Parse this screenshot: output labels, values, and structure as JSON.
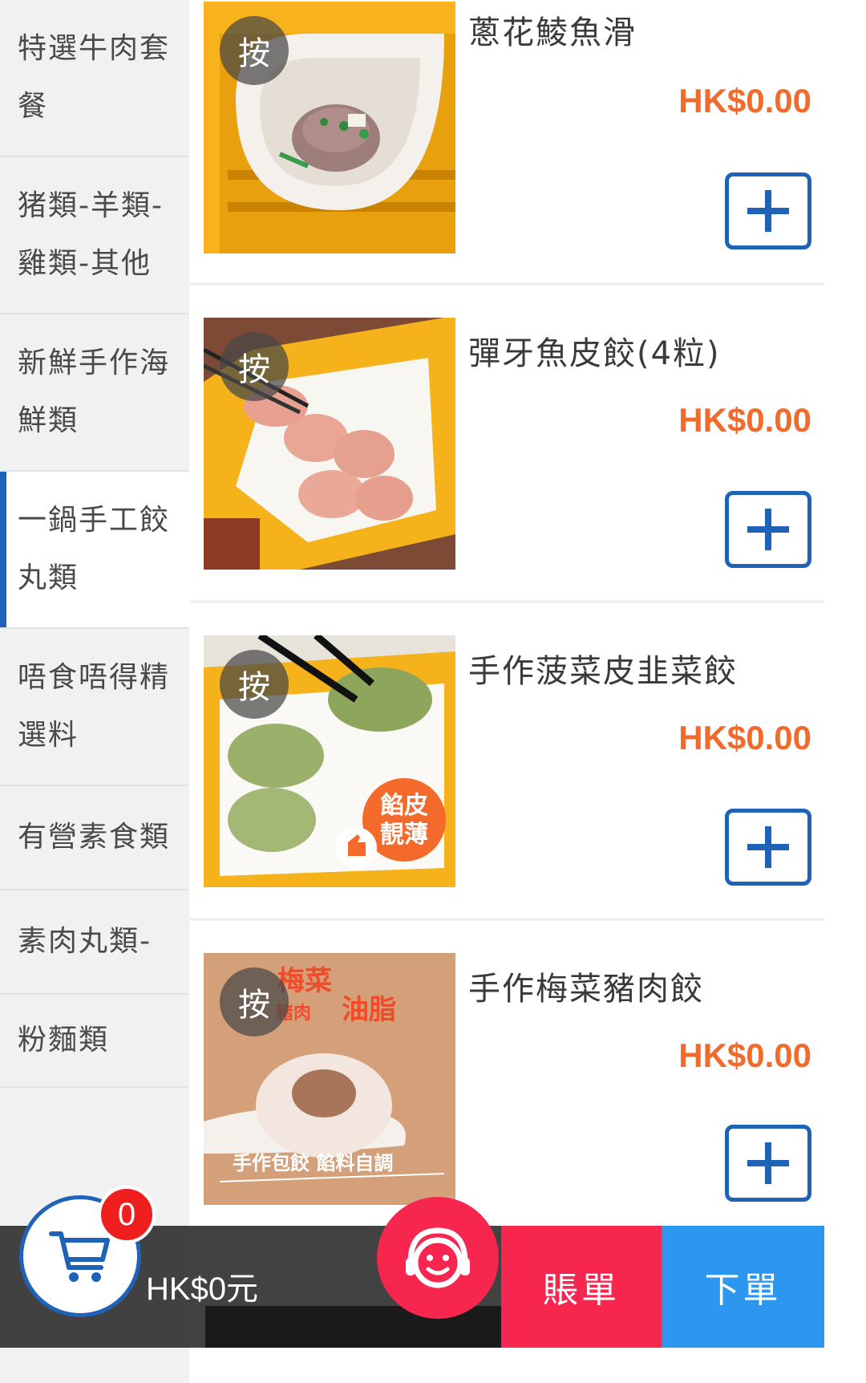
{
  "sidebar": {
    "categories": [
      {
        "label": "特選牛肉套餐"
      },
      {
        "label": "猪類-羊類-雞類-其他"
      },
      {
        "label": "新鮮手作海鮮類"
      },
      {
        "label": "一鍋手工餃丸類",
        "active": true
      },
      {
        "label": "唔食唔得精選料"
      },
      {
        "label": "有營素食類"
      },
      {
        "label": "素肉丸類-"
      },
      {
        "label": "粉麵類"
      }
    ]
  },
  "items": [
    {
      "badge": "按",
      "name": "蔥花鯪魚滑",
      "price": "HK$0.00"
    },
    {
      "badge": "按",
      "name": "彈牙魚皮餃(4粒)",
      "price": "HK$0.00"
    },
    {
      "badge": "按",
      "name": "手作菠菜皮韭菜餃",
      "price": "HK$0.00",
      "image_text": "餡皮靚薄"
    },
    {
      "badge": "按",
      "name": "手作梅菜豬肉餃",
      "price": "HK$0.00",
      "image_text": [
        "梅菜",
        "豬肉",
        "油脂",
        "手作包餃 餡料自調"
      ]
    }
  ],
  "cart": {
    "count": "0",
    "total": "HK$0元"
  },
  "actions": {
    "bill": "賬單",
    "order": "下單"
  },
  "colors": {
    "accent_blue": "#1e63b8",
    "price_orange": "#f06b2c",
    "bill_red": "#f6264f",
    "order_blue": "#2d97f0"
  },
  "icons": {
    "cart": "cart-icon",
    "support": "headset-icon",
    "add": "plus-icon"
  }
}
